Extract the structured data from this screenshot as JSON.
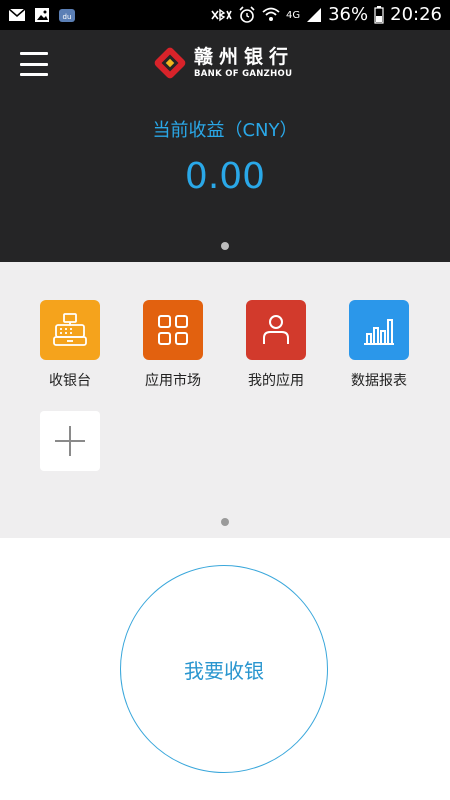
{
  "status_bar": {
    "time": "20:26",
    "battery": "36%",
    "network": "4G"
  },
  "header": {
    "logo_cn": "赣州银行",
    "logo_en": "BANK OF GANZHOU",
    "earnings_label": "当前收益（CNY）",
    "earnings_value": "0.00"
  },
  "apps": [
    {
      "label": "收银台",
      "color": "#f5a31c",
      "icon": "cash-register-icon"
    },
    {
      "label": "应用市场",
      "color": "#e2610f",
      "icon": "grid-icon"
    },
    {
      "label": "我的应用",
      "color": "#d23a2c",
      "icon": "user-icon"
    },
    {
      "label": "数据报表",
      "color": "#2b97ea",
      "icon": "bar-chart-icon"
    }
  ],
  "cash_button": {
    "label": "我要收银"
  },
  "colors": {
    "accent": "#2aa8e8",
    "header_bg": "#252526",
    "grid_bg": "#efeeef"
  }
}
